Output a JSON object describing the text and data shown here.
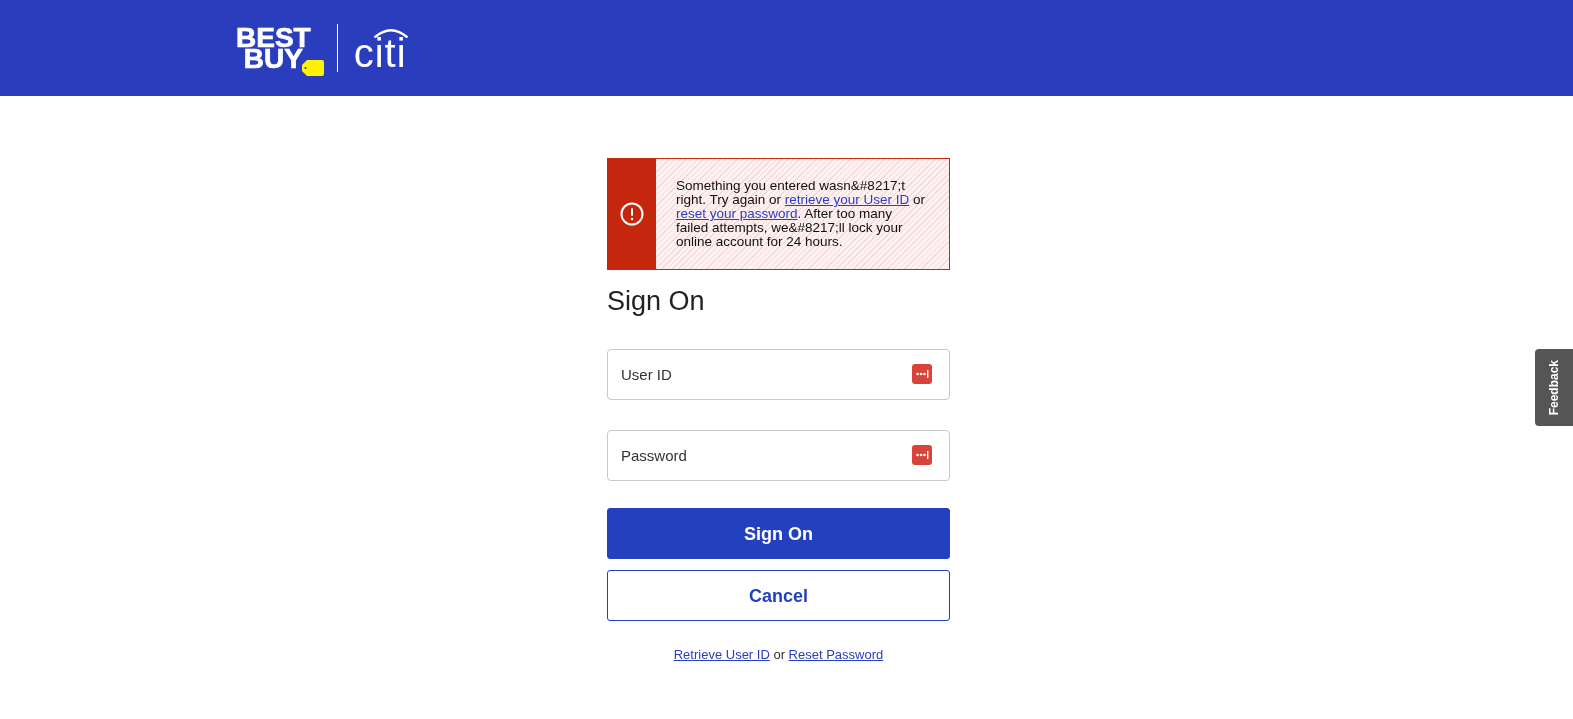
{
  "header": {
    "logo_lines": [
      "BEST",
      "BUY"
    ],
    "partner_logo": "citi"
  },
  "alert": {
    "message": [
      {
        "kind": "text",
        "text": "Something you entered wasn&#8217;t right. Try again or "
      },
      {
        "kind": "link",
        "text": "retrieve your User ID"
      },
      {
        "kind": "text",
        "text": " or "
      },
      {
        "kind": "link",
        "text": "reset your password"
      },
      {
        "kind": "text",
        "text": ". After too many failed attempts, we&#8217;ll lock your online account for 24 hours."
      }
    ]
  },
  "form": {
    "title": "Sign On",
    "fields": [
      {
        "placeholder": "User ID"
      },
      {
        "placeholder": "Password"
      }
    ],
    "buttons": [
      {
        "label": "Sign On",
        "kind": "primary"
      },
      {
        "label": "Cancel",
        "kind": "secondary"
      }
    ]
  },
  "help_links": [
    {
      "kind": "link",
      "text": "Retrieve User ID"
    },
    {
      "kind": "text",
      "text": " or "
    },
    {
      "kind": "link",
      "text": "Reset Password"
    }
  ],
  "feedback_tab": "Feedback"
}
